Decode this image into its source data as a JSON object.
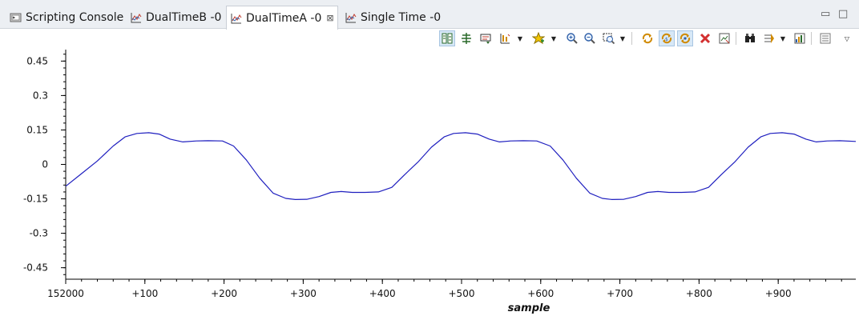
{
  "tabs": [
    {
      "label": "Scripting Console",
      "icon": "console-icon",
      "active": false
    },
    {
      "label": "DualTimeB -0",
      "icon": "graph-icon",
      "active": false
    },
    {
      "label": "DualTimeA -0",
      "icon": "graph-icon",
      "active": true,
      "close": "⊠"
    },
    {
      "label": "Single Time -0",
      "icon": "graph-icon",
      "active": false
    }
  ],
  "window_controls": {
    "minimize": "▭",
    "maximize": "□"
  },
  "colors": {
    "signal": "#1f1fbf",
    "axis": "#000000",
    "tab_bg": "#eceff3",
    "toolbar_toggle": "#d7e8f7"
  },
  "chart_data": {
    "type": "line",
    "xlabel": "sample",
    "xlim": [
      152000,
      152998
    ],
    "ylim": [
      -0.5,
      0.5
    ],
    "y_ticks": [
      0.45,
      0.3,
      0.15,
      0,
      -0.15,
      -0.3,
      -0.45
    ],
    "y_tick_labels": [
      "0.45",
      "0.3",
      "0.15",
      "0",
      "-0.15",
      "-0.3",
      "-0.45"
    ],
    "x_ticks": [
      152000,
      152100,
      152200,
      152300,
      152400,
      152500,
      152600,
      152700,
      152800,
      152900
    ],
    "x_tick_labels": [
      "152000",
      "+100",
      "+200",
      "+300",
      "+400",
      "+500",
      "+600",
      "+700",
      "+800",
      "+900"
    ],
    "series": [
      {
        "x": [
          152000,
          152020,
          152040,
          152060,
          152075,
          152090,
          152105,
          152118,
          152132,
          152148,
          152165,
          152180,
          152198,
          152212,
          152228,
          152245,
          152262,
          152278,
          152290,
          152305,
          152320,
          152335,
          152348,
          152362,
          152378,
          152395,
          152412,
          152428,
          152445,
          152462,
          152478,
          152490,
          152505,
          152520,
          152535,
          152548,
          152562,
          152578,
          152595,
          152612,
          152628,
          152645,
          152662,
          152678,
          152690,
          152705,
          152720,
          152735,
          152748,
          152762,
          152778,
          152795,
          152812,
          152828,
          152845,
          152862,
          152878,
          152890,
          152905,
          152920,
          152935,
          152948,
          152962,
          152978,
          152998
        ],
        "y": [
          -0.095,
          -0.04,
          0.015,
          0.08,
          0.12,
          0.135,
          0.138,
          0.132,
          0.11,
          0.098,
          0.102,
          0.103,
          0.102,
          0.08,
          0.02,
          -0.06,
          -0.125,
          -0.148,
          -0.153,
          -0.152,
          -0.14,
          -0.122,
          -0.118,
          -0.122,
          -0.122,
          -0.12,
          -0.1,
          -0.045,
          0.01,
          0.075,
          0.12,
          0.135,
          0.138,
          0.132,
          0.11,
          0.098,
          0.102,
          0.103,
          0.102,
          0.08,
          0.02,
          -0.06,
          -0.125,
          -0.148,
          -0.153,
          -0.152,
          -0.14,
          -0.122,
          -0.118,
          -0.122,
          -0.122,
          -0.12,
          -0.1,
          -0.045,
          0.01,
          0.075,
          0.12,
          0.135,
          0.138,
          0.132,
          0.11,
          0.098,
          0.102,
          0.103,
          0.1
        ]
      }
    ]
  }
}
